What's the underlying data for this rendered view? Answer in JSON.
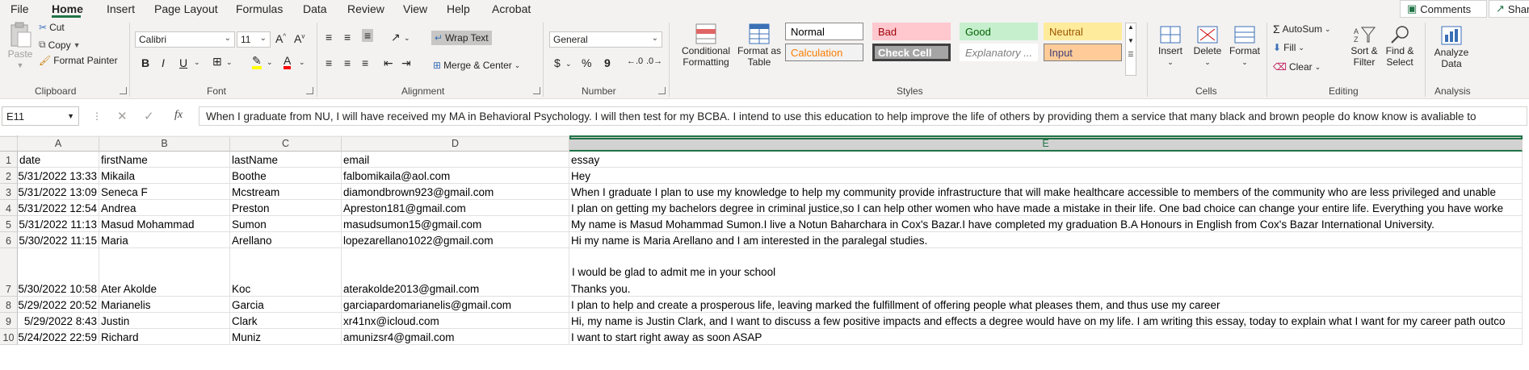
{
  "menu": {
    "items": [
      "File",
      "Home",
      "Insert",
      "Page Layout",
      "Formulas",
      "Data",
      "Review",
      "View",
      "Help",
      "Acrobat"
    ],
    "comments_label": "Comments",
    "share_label": "Share"
  },
  "ribbon": {
    "clipboard": {
      "paste": "Paste",
      "cut": "Cut",
      "copy": "Copy",
      "format_painter": "Format Painter",
      "label": "Clipboard"
    },
    "font": {
      "font_name": "Calibri",
      "font_size": "11",
      "bold": "B",
      "italic": "I",
      "underline": "U",
      "label": "Font"
    },
    "alignment": {
      "wrap_text": "Wrap Text",
      "merge_center": "Merge & Center",
      "label": "Alignment"
    },
    "number": {
      "format": "General",
      "currency": "$",
      "percent": "%",
      "comma": "9",
      "label": "Number"
    },
    "styles": {
      "conditional_formatting": "Conditional Formatting",
      "format_as_table": "Format as Table",
      "cells": [
        {
          "label": "Normal",
          "bg": "#ffffff",
          "fg": "#000000",
          "border": "#8a8886"
        },
        {
          "label": "Bad",
          "bg": "#ffc7ce",
          "fg": "#9c0006",
          "border": "#ffc7ce"
        },
        {
          "label": "Good",
          "bg": "#c6efce",
          "fg": "#006100",
          "border": "#c6efce"
        },
        {
          "label": "Neutral",
          "bg": "#ffeb9c",
          "fg": "#9c5700",
          "border": "#ffeb9c"
        },
        {
          "label": "Calculation",
          "bg": "#f2f2f2",
          "fg": "#fa7d00",
          "border": "#7f7f7f"
        },
        {
          "label": "Check Cell",
          "bg": "#a5a5a5",
          "fg": "#ffffff",
          "border": "#3f3f3f"
        },
        {
          "label": "Explanatory ...",
          "bg": "#ffffff",
          "fg": "#7f7f7f",
          "border": "#ffffff"
        },
        {
          "label": "Input",
          "bg": "#ffcc99",
          "fg": "#3f3f76",
          "border": "#7f7f7f"
        }
      ],
      "label": "Styles"
    },
    "cells": {
      "insert": "Insert",
      "delete": "Delete",
      "format": "Format",
      "label": "Cells"
    },
    "editing": {
      "autosum": "AutoSum",
      "fill": "Fill",
      "clear": "Clear",
      "sort_filter": "Sort & Filter",
      "find_select": "Find & Select",
      "label": "Editing"
    },
    "analysis": {
      "analyze_data": "Analyze Data",
      "label": "Analysis"
    }
  },
  "formula_bar": {
    "name_box": "E11",
    "fx": "fx",
    "content": "When I graduate from NU, I will have received my MA in Behavioral Psychology. I will then test for my BCBA. I intend to use this education to help improve the life of others by providing them a service that many black and brown people do know know is avaliable to"
  },
  "sheet": {
    "columns": [
      "A",
      "B",
      "C",
      "D",
      "E"
    ],
    "row_numbers": [
      "1",
      "2",
      "3",
      "4",
      "5",
      "6",
      "7",
      "8",
      "9",
      "10"
    ],
    "rows": [
      [
        "date",
        "firstName",
        "lastName",
        "email",
        "essay"
      ],
      [
        "5/31/2022 13:33",
        "Mikaila",
        "Boothe",
        "falbomikaila@aol.com",
        "Hey"
      ],
      [
        "5/31/2022 13:09",
        "Seneca F",
        "Mcstream",
        "diamondbrown923@gmail.com",
        "When I graduate I plan to use my knowledge to help my community provide infrastructure that will make healthcare accessible to members of the community who are less privileged and unable"
      ],
      [
        "5/31/2022 12:54",
        "Andrea",
        "Preston",
        "Apreston181@gmail.com",
        "I plan on getting my bachelors degree in criminal justice,so I can help other women who have made a mistake in their life. One bad choice can change your entire life. Everything you have worke"
      ],
      [
        "5/31/2022 11:13",
        "Masud Mohammad",
        "Sumon",
        "masudsumon15@gmail.com",
        "My name is Masud Mohammad Sumon.I live a Notun Baharchara in Cox's Bazar.I have completed my graduation B.A Honours in English from Cox's Bazar International University."
      ],
      [
        "5/30/2022 11:15",
        "Maria",
        "Arellano",
        "lopezarellano1022@gmail.com",
        "Hi my name is Maria Arellano and I am interested in the paralegal studies."
      ],
      [
        "5/30/2022 10:58",
        "Ater Akolde",
        "Koc",
        "aterakolde2013@gmail.com",
        "Thanks you."
      ],
      [
        "5/29/2022 20:52",
        "Marianelis",
        "Garcia",
        "garciapardomarianelis@gmail.com",
        "I plan to help and create a prosperous life, leaving marked the fulfillment of offering people what pleases them, and thus use my career"
      ],
      [
        "5/29/2022 8:43",
        "Justin",
        "Clark",
        "xr41nx@icloud.com",
        "Hi, my name is Justin Clark, and I want to discuss a few positive impacts and effects a degree would have on my life. I am writing this essay, today to explain what I want for my career path outco"
      ],
      [
        "5/24/2022 22:59",
        "Richard",
        "Muniz",
        "amunizsr4@gmail.com",
        "I want to start right away as soon ASAP"
      ]
    ],
    "row7_extra": "I would be glad to admit me in your school"
  }
}
